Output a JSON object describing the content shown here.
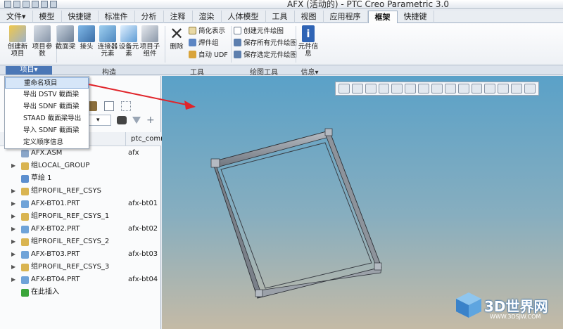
{
  "window": {
    "title": "AFX (活动的) - PTC Creo Parametric 3.0"
  },
  "ribbon_tabs": [
    "文件▾",
    "模型",
    "快捷键",
    "标准件",
    "分析",
    "注释",
    "渲染",
    "人体模型",
    "工具",
    "视图",
    "应用程序",
    "框架",
    "快捷键"
  ],
  "active_tab_index": 11,
  "ribbon": {
    "create_project": "创建新项目",
    "project_params": "项目参数",
    "section_beam": "截面梁",
    "joint": "接头",
    "connector_element": "连接器元素",
    "equipment_element": "设备元素",
    "project_sub_component": "项目子组件",
    "delete": "删除",
    "simplified_rep": "简化表示",
    "weld_group": "焊件组",
    "auto_udf": "自动 UDF",
    "create_component_drawing": "创建元件绘图",
    "save_all_component_drawings": "保存所有元件绘图",
    "save_selected_component_drawings": "保存选定元件绘图",
    "component_info": "元件信息"
  },
  "groups": {
    "project": "项目▾",
    "construct": "构造",
    "tools": "工具",
    "drawing_tools": "绘图工具",
    "info": "信息▾"
  },
  "context_menu": {
    "items": [
      "重命名项目",
      "导出 DSTV 截面梁",
      "导出 SDNF 截面梁",
      "STAAD 截面梁导出",
      "导入 SDNF 截面梁",
      "定义顺序信息"
    ],
    "highlighted_index": 0
  },
  "tree": {
    "column_param": "ptc_comn",
    "rows": [
      {
        "label": "AFX.ASM",
        "value": "afx",
        "expand": "",
        "icon_color": "#8aa6c9"
      },
      {
        "label": "组LOCAL_GROUP",
        "value": "",
        "expand": "▶",
        "icon_color": "#d9b451"
      },
      {
        "label": "草绘 1",
        "value": "",
        "expand": "",
        "icon_color": "#5c8fcf"
      },
      {
        "label": "组PROFIL_REF_CSYS",
        "value": "",
        "expand": "▶",
        "icon_color": "#d9b451"
      },
      {
        "label": "AFX-BT01.PRT",
        "value": "afx-bt01",
        "expand": "▶",
        "icon_color": "#6fa3d8"
      },
      {
        "label": "组PROFIL_REF_CSYS_1",
        "value": "",
        "expand": "▶",
        "icon_color": "#d9b451"
      },
      {
        "label": "AFX-BT02.PRT",
        "value": "afx-bt02",
        "expand": "▶",
        "icon_color": "#6fa3d8"
      },
      {
        "label": "组PROFIL_REF_CSYS_2",
        "value": "",
        "expand": "▶",
        "icon_color": "#d9b451"
      },
      {
        "label": "AFX-BT03.PRT",
        "value": "afx-bt03",
        "expand": "▶",
        "icon_color": "#6fa3d8"
      },
      {
        "label": "组PROFIL_REF_CSYS_3",
        "value": "",
        "expand": "▶",
        "icon_color": "#d9b451"
      },
      {
        "label": "AFX-BT04.PRT",
        "value": "afx-bt04",
        "expand": "▶",
        "icon_color": "#6fa3d8"
      },
      {
        "label": "在此插入",
        "value": "",
        "expand": "",
        "icon_color": "#3aa53a"
      }
    ]
  },
  "watermark": {
    "text": "3D世界网",
    "sub": "WWW.3DSJW.COM"
  },
  "colors": {
    "accent": "#4b77b6",
    "viewport_top": "#5aa1c8",
    "viewport_bottom": "#c4baa6",
    "annotation_arrow": "#e0242a"
  }
}
